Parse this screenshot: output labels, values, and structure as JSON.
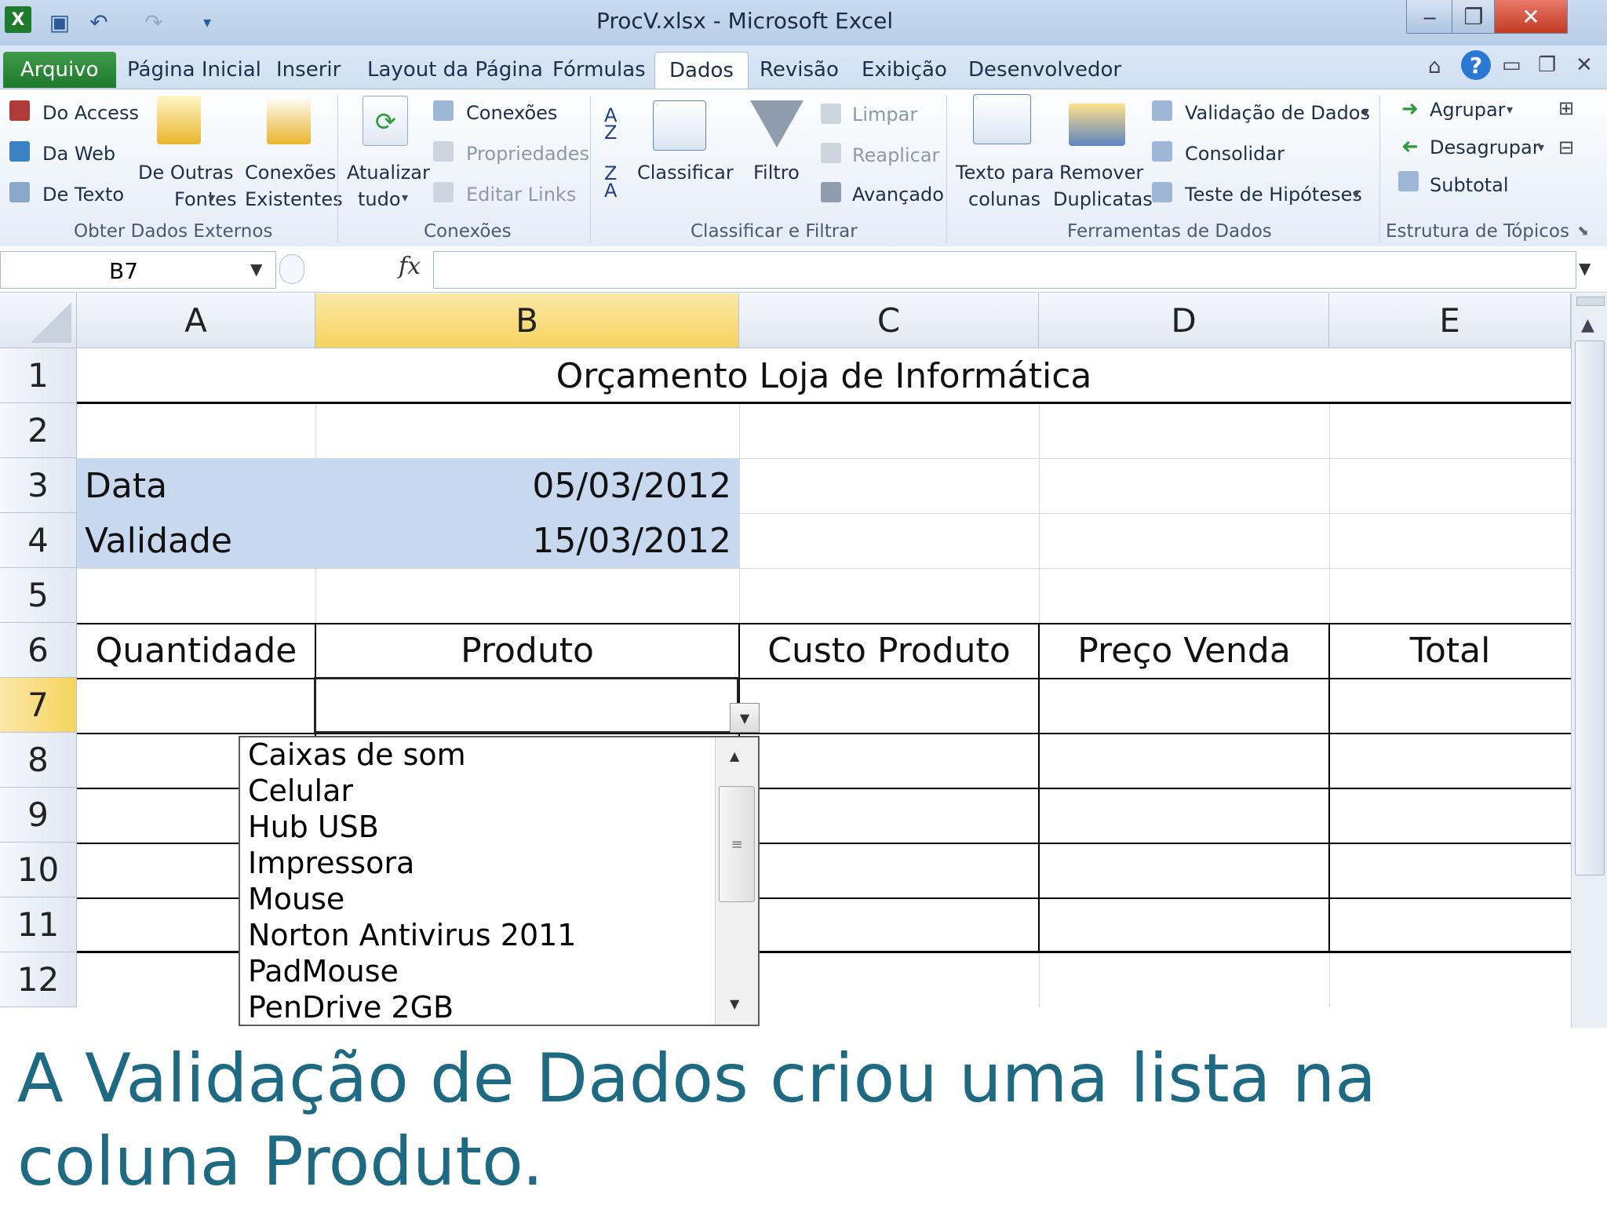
{
  "window": {
    "title": "ProcV.xlsx  -  Microsoft Excel"
  },
  "tabs": {
    "file": "Arquivo",
    "items": [
      "Página Inicial",
      "Inserir",
      "Layout da Página",
      "Fórmulas",
      "Dados",
      "Revisão",
      "Exibição",
      "Desenvolvedor"
    ],
    "active": "Dados"
  },
  "ribbon": {
    "external": {
      "access": "Do Access",
      "web": "Da Web",
      "text": "De Texto",
      "other_line1": "De Outras",
      "other_line2": "Fontes",
      "existing_line1": "Conexões",
      "existing_line2": "Existentes",
      "group": "Obter Dados Externos"
    },
    "connections": {
      "refresh_line1": "Atualizar",
      "refresh_line2": "tudo",
      "connections": "Conexões",
      "properties": "Propriedades",
      "edit_links": "Editar Links",
      "group": "Conexões"
    },
    "sort": {
      "sort": "Classificar",
      "filter": "Filtro",
      "clear": "Limpar",
      "reapply": "Reaplicar",
      "advanced": "Avançado",
      "group": "Classificar e Filtrar"
    },
    "datatools": {
      "text_cols_line1": "Texto para",
      "text_cols_line2": "colunas",
      "remove_dup_line1": "Remover",
      "remove_dup_line2": "Duplicatas",
      "validation": "Validação de Dados",
      "consolidate": "Consolidar",
      "whatif": "Teste de Hipóteses",
      "group": "Ferramentas de Dados"
    },
    "outline": {
      "group_btn": "Agrupar",
      "ungroup": "Desagrupar",
      "subtotal": "Subtotal",
      "group": "Estrutura de Tópicos"
    }
  },
  "formula_bar": {
    "name_box": "B7",
    "fx": "fx",
    "value": ""
  },
  "sheet": {
    "columns": [
      "A",
      "B",
      "C",
      "D",
      "E"
    ],
    "rows": [
      "1",
      "2",
      "3",
      "4",
      "5",
      "6",
      "7",
      "8",
      "9",
      "10",
      "11",
      "12"
    ],
    "title": "Orçamento Loja de Informática",
    "data_label": "Data",
    "data_value": "05/03/2012",
    "validade_label": "Validade",
    "validade_value": "15/03/2012",
    "headers": [
      "Quantidade",
      "Produto",
      "Custo Produto",
      "Preço Venda",
      "Total"
    ]
  },
  "dropdown": {
    "items": [
      "Caixas de som",
      "Celular",
      "Hub USB",
      "Impressora",
      "Mouse",
      "Norton Antivirus 2011",
      "PadMouse",
      "PenDrive 2GB"
    ]
  },
  "caption": "A Validação de Dados criou uma lista na coluna Produto.",
  "colors": {
    "selection_header": "#f6d35e",
    "highlight_fill": "#c8d9ef",
    "caption": "#1e6a82",
    "file_tab": "#2e8a3a"
  }
}
